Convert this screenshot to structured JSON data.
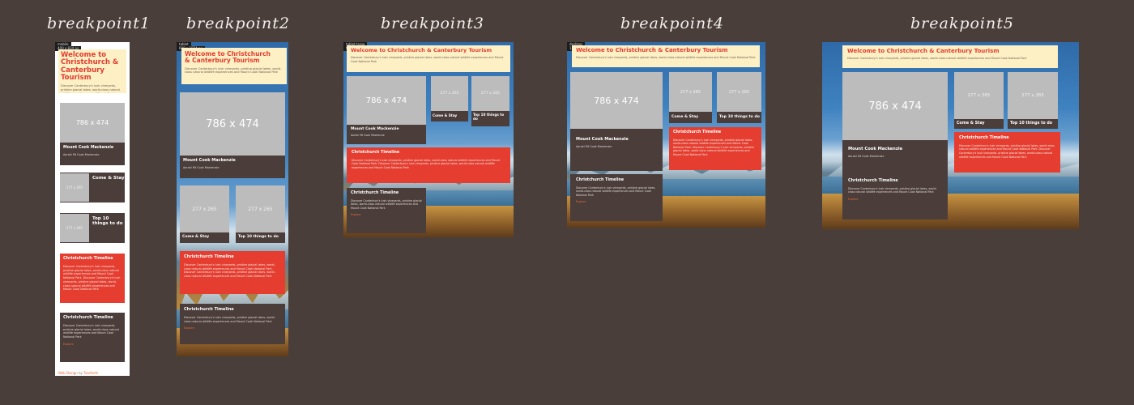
{
  "bp_labels": [
    "breakpoint1",
    "breakpoint2",
    "breakpoint3",
    "breakpoint4",
    "breakpoint5"
  ],
  "bars": {
    "bp1_device": "mobile",
    "bp1_ctl": "400 x 834 px",
    "bp2_device": "tablet",
    "bp2_ctl": "600 x 1024 px",
    "bp3_device": "tablet-large",
    "bp3_ctl": "960 x 1024 px",
    "bp4_device": "desktop",
    "bp4_ctl": "1366 x 1024 px"
  },
  "site": {
    "title": "Welcome to Christchurch & Canterbury Tourism",
    "intro": "Discover Canterbury's lush vineyards, pristine glacial lakes, world-class natural wildlife experiences and Mount Cook National Park",
    "placeholder_large": "786 x 474",
    "placeholder_small": "277 x 265",
    "mount_cook": "Mount Cook Mackenzie",
    "mount_cook_sub": "Aoraki Mt Cook Mackenzie",
    "come_stay": "Come & Stay",
    "top10": "Top 10 things to do",
    "timeline": "Christchurch Timeline",
    "timeline_text": "Discover Canterbury's lush vineyards, pristine glacial lakes, world-class natural wildlife experiences and Mount Cook National Park. Discover Canterbury's lush vineyards, pristine glacial lakes, world-class natural wildlife experiences and Mount Cook National Park",
    "timeline_text_short": "Discover Canterbury's lush vineyards, pristine glacial lakes, world-class natural wildlife experiences and Mount Cook National Park",
    "explore": "Explore"
  },
  "footer": {
    "prefix": "Web Design",
    "by": "by",
    "who": "Tandhofs"
  },
  "colors": {
    "background": "#4a3e3b",
    "header": "#fdf0c4",
    "title_red": "#e33b2f",
    "card_brown": "#4a3d3a",
    "card_red": "#e53d2f",
    "placeholder": "#bcbcbc"
  }
}
